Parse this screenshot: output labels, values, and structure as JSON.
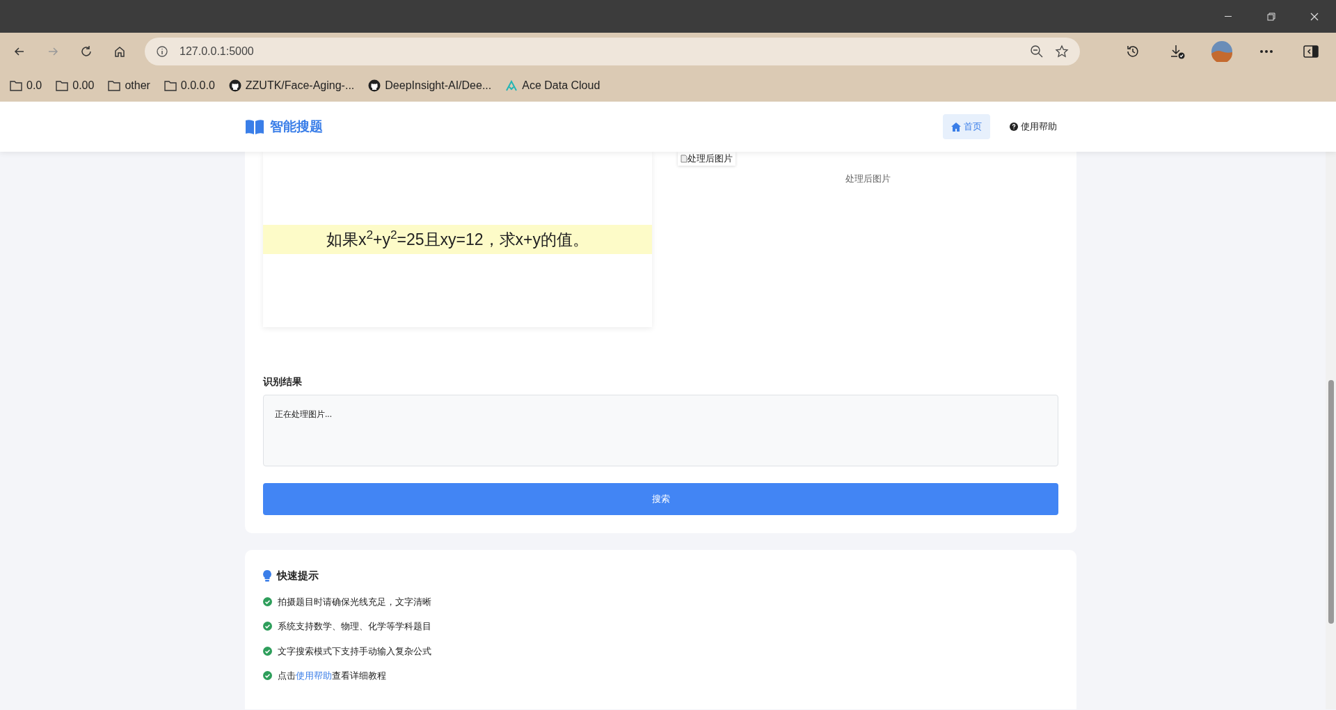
{
  "browser": {
    "address": "127.0.0.1:5000",
    "bookmarks": [
      {
        "label": "0.0",
        "kind": "folder"
      },
      {
        "label": "0.00",
        "kind": "folder"
      },
      {
        "label": "other",
        "kind": "folder"
      },
      {
        "label": "0.0.0.0",
        "kind": "folder"
      },
      {
        "label": "ZZUTK/Face-Aging-...",
        "kind": "github"
      },
      {
        "label": "DeepInsight-AI/Dee...",
        "kind": "github"
      },
      {
        "label": "Ace Data Cloud",
        "kind": "site"
      }
    ]
  },
  "navbar": {
    "brand": "智能搜题",
    "links": [
      {
        "label": "首页",
        "kind": "home",
        "selected": true
      },
      {
        "label": "使用帮助",
        "kind": "help",
        "selected": false
      }
    ]
  },
  "upload": {
    "question_image_text": "如果x$^{2}$+y$^{2}$=25且xy=12，求x+y的值。",
    "processed_image_alt": "处理后图片",
    "processed_caption": "处理后图片"
  },
  "result": {
    "label": "识别结果",
    "value": "正在处理图片..."
  },
  "search_button": "搜索",
  "tips": {
    "title": "快速提示",
    "items": [
      {
        "text": "拍摄题目时请确保光线充足，文字清晰"
      },
      {
        "text": "系统支持数学、物理、化学等学科题目"
      },
      {
        "text": "文字搜索模式下支持手动输入复杂公式"
      },
      {
        "text": "点击",
        "link": "使用帮助",
        "after": "查看详细教程"
      }
    ]
  }
}
